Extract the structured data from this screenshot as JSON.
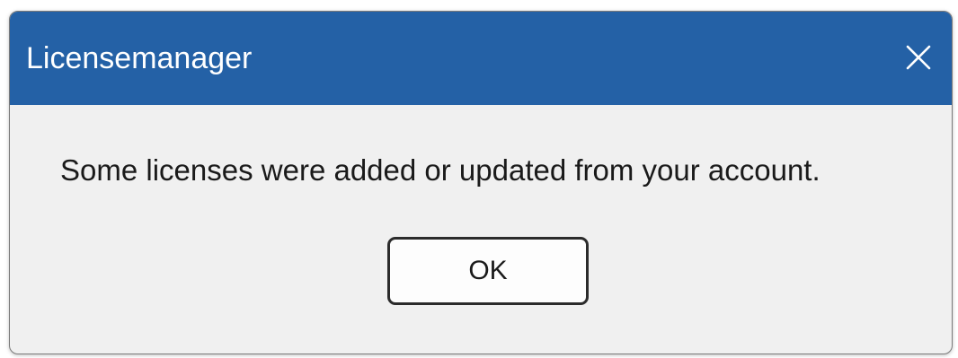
{
  "window": {
    "title": "Licensemanager",
    "close_icon": "close-icon"
  },
  "dialog": {
    "message": "Some licenses were added or updated from your account.",
    "ok_label": "OK"
  },
  "colors": {
    "titlebar": "#2461a6",
    "body": "#f0f0f0",
    "text": "#1a1a1a",
    "title_text": "#ffffff"
  }
}
